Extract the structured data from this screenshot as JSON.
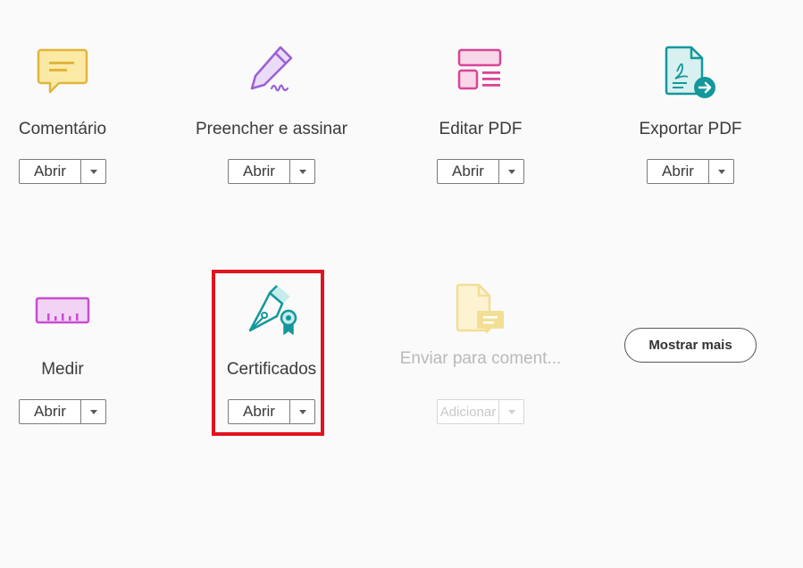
{
  "tools": [
    {
      "name": "Comentário",
      "button": "Abrir",
      "icon": "comment-icon",
      "color": "#e0b53a"
    },
    {
      "name": "Preencher e assinar",
      "button": "Abrir",
      "icon": "fill-sign-icon",
      "color": "#9b5fd6"
    },
    {
      "name": "Editar PDF",
      "button": "Abrir",
      "icon": "edit-pdf-icon",
      "color": "#d94597"
    },
    {
      "name": "Exportar PDF",
      "button": "Abrir",
      "icon": "export-pdf-icon",
      "color": "#13979b"
    },
    {
      "name": "Medir",
      "button": "Abrir",
      "icon": "measure-icon",
      "color": "#c64ed0"
    },
    {
      "name": "Certificados",
      "button": "Abrir",
      "icon": "certificates-icon",
      "color": "#13979b"
    },
    {
      "name": "Enviar para coment...",
      "button": "Adicionar",
      "icon": "send-for-comments-icon",
      "color": "#f2de94"
    }
  ],
  "show_more_label": "Mostrar mais",
  "highlight_color": "#e0141e"
}
